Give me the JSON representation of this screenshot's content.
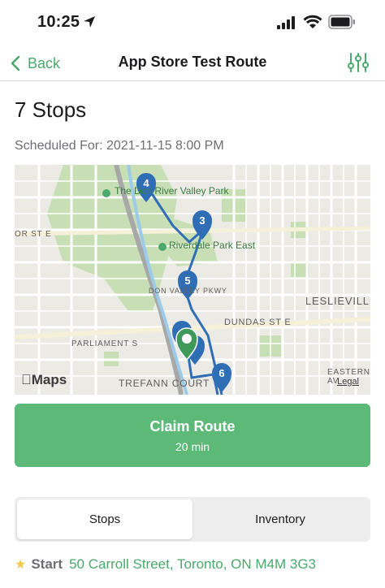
{
  "status_bar": {
    "time": "10:25"
  },
  "nav": {
    "back_label": "Back",
    "title": "App Store Test Route"
  },
  "header": {
    "stops_count": "7 Stops",
    "scheduled": "Scheduled For: 2021-11-15 8:00 PM"
  },
  "map": {
    "labels": [
      "The Don River Valley Park",
      "Riverdale Park East",
      "DUNDAS ST E",
      "LESLIEVILLE",
      "PARLIAMENT S",
      "EASTERN AV",
      "TREFANN COURT",
      "DON VALLEY PKWY",
      "OR ST E"
    ],
    "markers": [
      "4",
      "3",
      "5",
      "6"
    ],
    "brand": "Maps",
    "legal": "Legal"
  },
  "claim": {
    "label": "Claim Route",
    "duration": "20 min"
  },
  "tabs": {
    "stops": "Stops",
    "inventory": "Inventory"
  },
  "start": {
    "label": "Start",
    "address": "50 Carroll Street, Toronto, ON M4M 3G3"
  },
  "colors": {
    "accent": "#4aa96c",
    "button": "#5cb978",
    "marker": "#2f6db5",
    "route": "#2f6db5"
  }
}
